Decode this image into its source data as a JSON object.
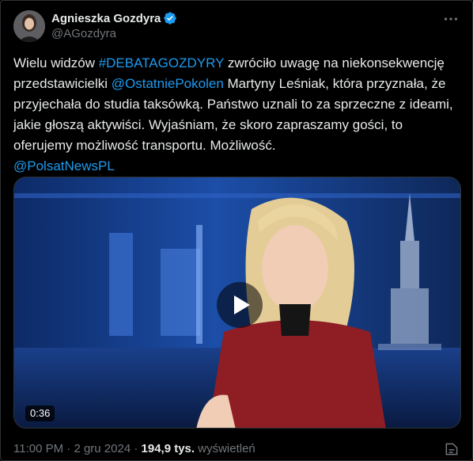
{
  "author": {
    "name": "Agnieszka Gozdyra",
    "handle": "@AGozdyra"
  },
  "tweet": {
    "part1": "Wielu widzów ",
    "hashtag": "#DEBATAGOZDYRY",
    "part2": " zwróciło uwagę na niekonsekwencję przedstawicielki ",
    "mention1": "@OstatniePokolen",
    "part3": " Martyny Leśniak, która przyznała, że przyjechała do studia taksówką. Państwo uznali to za sprzeczne z ideami, jakie głoszą aktywiści. Wyjaśniam, że skoro zapraszamy gości, to oferujemy możliwość transportu. Możliwość.",
    "mention2": "@PolsatNewsPL"
  },
  "video": {
    "duration": "0:36"
  },
  "meta": {
    "time": "11:00 PM",
    "sep1": " · ",
    "date": "2 gru 2024",
    "sep2": " · ",
    "views_count": "194,9 tys.",
    "views_label": " wyświetleń"
  },
  "colors": {
    "link": "#1d9bf0",
    "verified": "#1d9bf0",
    "secondary_text": "#71767b"
  },
  "icons": [
    "verified-badge-icon",
    "more-icon",
    "play-icon",
    "analytics-icon"
  ]
}
